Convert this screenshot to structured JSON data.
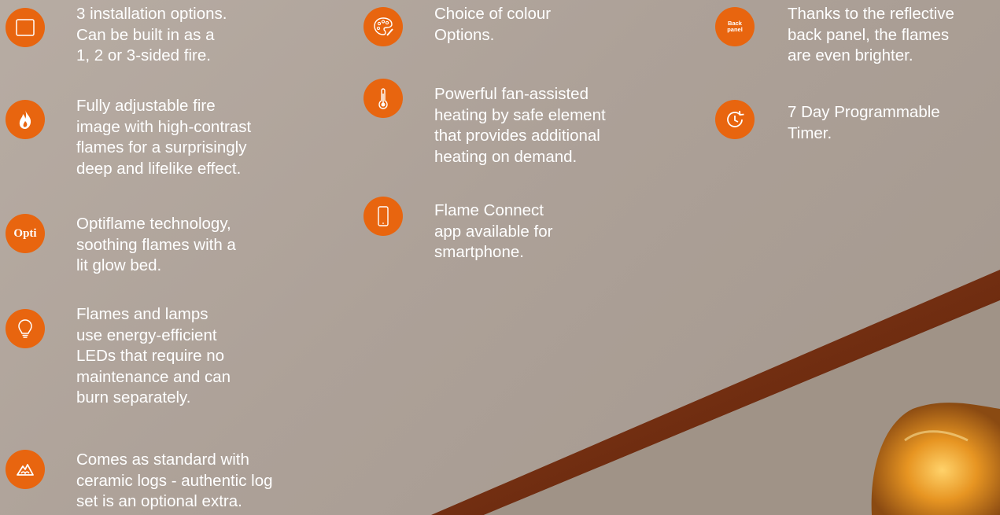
{
  "columns": [
    {
      "features": [
        {
          "icon": "square-icon",
          "lines": [
            "3 installation options.",
            "Can be built in as a",
            "1, 2 or 3-sided fire."
          ]
        },
        {
          "icon": "flame-icon",
          "lines": [
            "Fully adjustable fire",
            "image with high-contrast",
            "flames for a surprisingly",
            "deep and lifelike effect."
          ]
        },
        {
          "icon": "optiflame-icon",
          "icon_text": "Opti",
          "lines": [
            "Optiflame technology,",
            "soothing flames with a",
            "lit glow bed."
          ]
        },
        {
          "icon": "lightbulb-icon",
          "lines": [
            "Flames and lamps",
            "use energy-efficient",
            "LEDs that require no",
            "maintenance and can",
            "burn separately."
          ]
        },
        {
          "icon": "log-set-icon",
          "lines": [
            "Comes as standard with",
            "ceramic logs - authentic log",
            "set is an optional extra."
          ]
        }
      ]
    },
    {
      "features": [
        {
          "icon": "palette-icon",
          "lines": [
            "Choice of colour",
            "Options."
          ]
        },
        {
          "icon": "thermometer-icon",
          "lines": [
            "Powerful fan-assisted",
            "heating by safe element",
            "that provides additional",
            "heating on demand."
          ]
        },
        {
          "icon": "smartphone-icon",
          "lines": [
            "Flame Connect",
            "app available for",
            "smartphone."
          ]
        }
      ]
    },
    {
      "features": [
        {
          "icon": "back-panel-icon",
          "icon_text": [
            "Back",
            "panel"
          ],
          "lines": [
            "Thanks to the reflective",
            "back panel, the flames",
            "are even brighter."
          ]
        },
        {
          "icon": "timer-icon",
          "lines": [
            "7 Day Programmable",
            "Timer."
          ]
        }
      ]
    }
  ],
  "colors": {
    "accent": "#e8650f",
    "text": "#ffffff",
    "wall": "#b1a59c",
    "trim": "#6b2a10"
  }
}
